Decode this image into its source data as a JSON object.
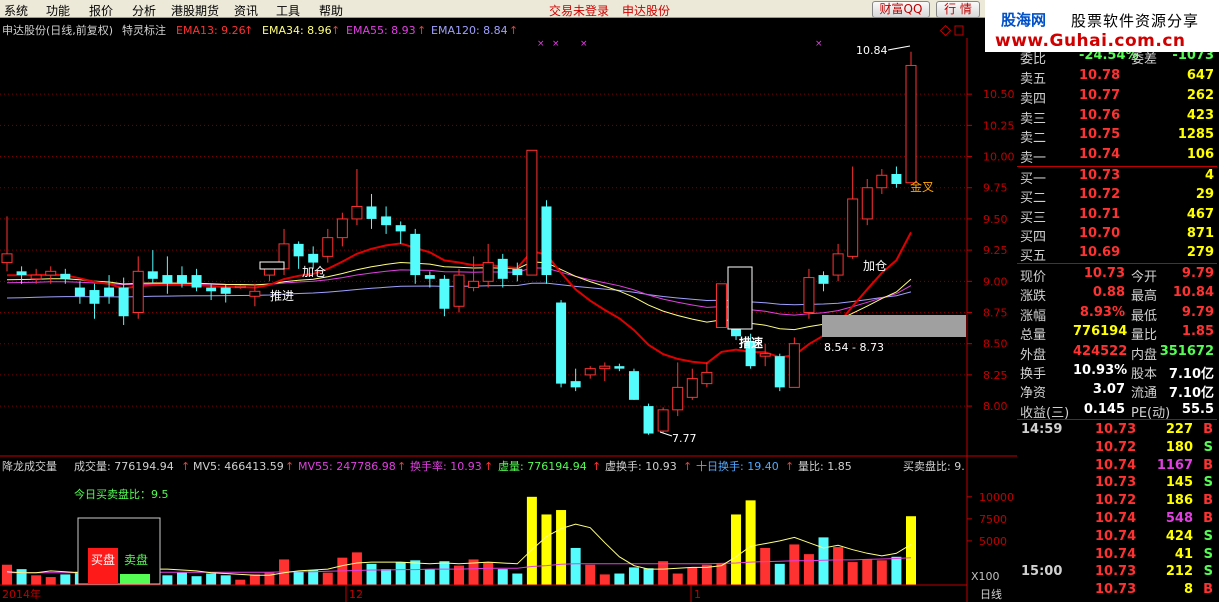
{
  "menu": {
    "items": [
      "系统",
      "功能",
      "报价",
      "分析",
      "港股期货",
      "资讯",
      "工具",
      "帮助"
    ],
    "notice_login": "交易未登录",
    "notice_stock": "申达股份",
    "btn_wealth": "财富QQ",
    "btn_quote": "行 情"
  },
  "logo": {
    "name": "股海网",
    "slogan": "股票软件资源分享",
    "url": "www.Guhai.com.cn"
  },
  "chart_header": {
    "stock": "申达股份(日线,前复权)",
    "indicator": "特灵标注",
    "ema13": "EMA13: 9.26",
    "ema34": "EMA34: 8.96",
    "ema55": "EMA55: 8.93",
    "ema120": "EMA120: 8.84"
  },
  "colors": {
    "up": "#ff3232",
    "down": "#54fcfc",
    "ema13": "#e00000",
    "ema34": "#ffff7f",
    "ema55": "#e040e0",
    "ema120": "#a0a0ff",
    "grid": "#7a0000",
    "axis": "#c00000"
  },
  "annotations": {
    "tuijin": "推进",
    "jiacang1": "加仓",
    "jiacang2": "加仓",
    "cuosu": "措速",
    "jincha": "金叉",
    "high_label": "10.84",
    "low_label": "7.77",
    "range_label": "8.54 - 8.73"
  },
  "price_axis": [
    "10.50",
    "10.25",
    "10.00",
    "9.75",
    "9.50",
    "9.25",
    "9.00",
    "8.75",
    "8.50",
    "8.25",
    "8.00"
  ],
  "vol_axis": [
    "10000",
    "7500",
    "5000"
  ],
  "vol_header": {
    "title": "降龙成交量",
    "vol": "成交量: 776194.94",
    "mv5": "MV5: 466413.59",
    "mv55": "MV55: 247786.98",
    "turnover": "换手率: 10.93",
    "vvol": "虚量: 776194.94",
    "vturn": "虚换手: 10.93",
    "ten_turn": "十日换手: 19.40",
    "ratio": "量比: 1.85",
    "bs_ratio": "买卖盘比: 9."
  },
  "today_ratio": "今日买卖盘比：9.5",
  "buy_label": "买盘",
  "sell_label": "卖盘",
  "x_labels": [
    "2014年",
    "12",
    "1"
  ],
  "x100": "X100",
  "period": "日线",
  "chart_data": {
    "type": "candlestick",
    "ylim": [
      7.6,
      10.95
    ],
    "candles": [
      {
        "o": 9.15,
        "c": 9.22,
        "h": 9.52,
        "l": 9.08
      },
      {
        "o": 9.08,
        "c": 9.05,
        "h": 9.12,
        "l": 8.98
      },
      {
        "o": 9.02,
        "c": 9.05,
        "h": 9.1,
        "l": 8.98
      },
      {
        "o": 9.05,
        "c": 9.08,
        "h": 9.12,
        "l": 8.98
      },
      {
        "o": 9.06,
        "c": 9.02,
        "h": 9.1,
        "l": 8.98
      },
      {
        "o": 8.95,
        "c": 8.88,
        "h": 9.0,
        "l": 8.82
      },
      {
        "o": 8.93,
        "c": 8.82,
        "h": 8.98,
        "l": 8.7
      },
      {
        "o": 8.95,
        "c": 8.88,
        "h": 9.05,
        "l": 8.82
      },
      {
        "o": 8.95,
        "c": 8.72,
        "h": 9.03,
        "l": 8.65
      },
      {
        "o": 8.75,
        "c": 9.08,
        "h": 9.2,
        "l": 8.7
      },
      {
        "o": 9.08,
        "c": 9.02,
        "h": 9.25,
        "l": 8.98
      },
      {
        "o": 9.05,
        "c": 8.98,
        "h": 9.2,
        "l": 8.9
      },
      {
        "o": 9.05,
        "c": 8.98,
        "h": 9.12,
        "l": 8.95
      },
      {
        "o": 9.05,
        "c": 8.95,
        "h": 9.1,
        "l": 8.92
      },
      {
        "o": 8.95,
        "c": 8.92,
        "h": 8.98,
        "l": 8.85
      },
      {
        "o": 8.95,
        "c": 8.9,
        "h": 8.97,
        "l": 8.83
      },
      {
        "o": 8.95,
        "c": 8.96,
        "h": 8.97,
        "l": 8.94
      },
      {
        "o": 8.88,
        "c": 8.92,
        "h": 8.98,
        "l": 8.8
      },
      {
        "o": 9.05,
        "c": 9.1,
        "h": 9.12,
        "l": 9.0
      },
      {
        "o": 9.1,
        "c": 9.3,
        "h": 9.42,
        "l": 9.05
      },
      {
        "o": 9.3,
        "c": 9.2,
        "h": 9.32,
        "l": 9.1
      },
      {
        "o": 9.22,
        "c": 9.15,
        "h": 9.28,
        "l": 9.1
      },
      {
        "o": 9.2,
        "c": 9.35,
        "h": 9.42,
        "l": 9.15
      },
      {
        "o": 9.35,
        "c": 9.5,
        "h": 9.55,
        "l": 9.28
      },
      {
        "o": 9.5,
        "c": 9.6,
        "h": 9.9,
        "l": 9.45
      },
      {
        "o": 9.6,
        "c": 9.5,
        "h": 9.7,
        "l": 9.42
      },
      {
        "o": 9.52,
        "c": 9.45,
        "h": 9.6,
        "l": 9.38
      },
      {
        "o": 9.45,
        "c": 9.4,
        "h": 9.48,
        "l": 9.3
      },
      {
        "o": 9.38,
        "c": 9.05,
        "h": 9.42,
        "l": 8.98
      },
      {
        "o": 9.05,
        "c": 9.02,
        "h": 9.08,
        "l": 8.95
      },
      {
        "o": 9.02,
        "c": 8.78,
        "h": 9.05,
        "l": 8.72
      },
      {
        "o": 8.8,
        "c": 9.05,
        "h": 9.1,
        "l": 8.75
      },
      {
        "o": 8.95,
        "c": 9.0,
        "h": 9.2,
        "l": 8.92
      },
      {
        "o": 9.0,
        "c": 9.15,
        "h": 9.3,
        "l": 8.95
      },
      {
        "o": 9.18,
        "c": 9.02,
        "h": 9.22,
        "l": 8.95
      },
      {
        "o": 9.1,
        "c": 9.05,
        "h": 9.15,
        "l": 9.0
      },
      {
        "o": 9.05,
        "c": 10.05,
        "h": 10.05,
        "l": 9.05
      },
      {
        "o": 9.6,
        "c": 9.05,
        "h": 9.65,
        "l": 8.98
      },
      {
        "o": 8.83,
        "c": 8.18,
        "h": 8.85,
        "l": 8.15
      },
      {
        "o": 8.2,
        "c": 8.15,
        "h": 8.3,
        "l": 8.12
      },
      {
        "o": 8.25,
        "c": 8.3,
        "h": 8.32,
        "l": 8.22
      },
      {
        "o": 8.3,
        "c": 8.32,
        "h": 8.35,
        "l": 8.2
      },
      {
        "o": 8.32,
        "c": 8.3,
        "h": 8.34,
        "l": 8.28
      },
      {
        "o": 8.28,
        "c": 8.05,
        "h": 8.3,
        "l": 8.05
      },
      {
        "o": 8.0,
        "c": 7.78,
        "h": 8.02,
        "l": 7.77
      },
      {
        "o": 7.8,
        "c": 7.97,
        "h": 7.99,
        "l": 7.78
      },
      {
        "o": 7.97,
        "c": 8.15,
        "h": 8.35,
        "l": 7.92
      },
      {
        "o": 8.07,
        "c": 8.22,
        "h": 8.3,
        "l": 8.05
      },
      {
        "o": 8.18,
        "c": 8.27,
        "h": 8.35,
        "l": 8.15
      },
      {
        "o": 8.63,
        "c": 8.98,
        "h": 8.98,
        "l": 8.63
      },
      {
        "o": 8.79,
        "c": 8.56,
        "h": 8.82,
        "l": 8.53
      },
      {
        "o": 8.52,
        "c": 8.32,
        "h": 8.58,
        "l": 8.3
      },
      {
        "o": 8.4,
        "c": 8.42,
        "h": 8.5,
        "l": 8.32
      },
      {
        "o": 8.4,
        "c": 8.15,
        "h": 8.42,
        "l": 8.12
      },
      {
        "o": 8.15,
        "c": 8.5,
        "h": 8.55,
        "l": 8.15
      },
      {
        "o": 8.75,
        "c": 9.03,
        "h": 9.1,
        "l": 8.7
      },
      {
        "o": 9.05,
        "c": 8.98,
        "h": 9.08,
        "l": 8.92
      },
      {
        "o": 9.05,
        "c": 9.22,
        "h": 9.3,
        "l": 9.0
      },
      {
        "o": 9.2,
        "c": 9.66,
        "h": 9.92,
        "l": 9.18
      },
      {
        "o": 9.5,
        "c": 9.75,
        "h": 9.82,
        "l": 9.45
      },
      {
        "o": 9.75,
        "c": 9.85,
        "h": 9.9,
        "l": 9.7
      },
      {
        "o": 9.86,
        "c": 9.78,
        "h": 9.92,
        "l": 9.75
      },
      {
        "o": 9.79,
        "c": 10.73,
        "h": 10.84,
        "l": 9.79
      }
    ],
    "volume_scale_max": 11000,
    "volumes": [
      2300,
      1800,
      1100,
      900,
      1200,
      1500,
      1800,
      1100,
      1400,
      2900,
      1700,
      1100,
      1400,
      1000,
      1300,
      1100,
      600,
      1200,
      1400,
      2900,
      1500,
      1700,
      1400,
      3100,
      3700,
      2400,
      1800,
      2600,
      2800,
      1800,
      2700,
      2200,
      2900,
      2600,
      1800,
      1300,
      10000,
      8000,
      8500,
      4200,
      2300,
      1200,
      1300,
      2000,
      1900,
      2700,
      1300,
      2000,
      2300,
      2400,
      8000,
      9600,
      4200,
      2400,
      4600,
      3500,
      5400,
      4300,
      2600,
      2900,
      2800,
      3200,
      7800
    ],
    "mv5": [
      1500,
      1400,
      1400,
      1600,
      1500,
      1400,
      1400,
      1400,
      1600,
      1800,
      1800,
      1800,
      1700,
      1600,
      1400,
      1300,
      1200,
      1100,
      1100,
      1400,
      1600,
      1700,
      1800,
      2200,
      2500,
      2600,
      2600,
      2600,
      2500,
      2400,
      2500,
      2400,
      2500,
      2600,
      2500,
      2400,
      4000,
      5500,
      6400,
      6900,
      6500,
      4800,
      3200,
      2200,
      1800,
      1800,
      1900,
      2000,
      2000,
      2200,
      3200,
      4400,
      4700,
      5000,
      5400,
      4800,
      4200,
      4500,
      4000,
      3600,
      3300,
      3600,
      4600
    ],
    "mv55": [
      1400,
      1400,
      1400,
      1400,
      1400,
      1400,
      1400,
      1400,
      1400,
      1450,
      1450,
      1450,
      1450,
      1450,
      1450,
      1450,
      1450,
      1450,
      1450,
      1500,
      1500,
      1500,
      1550,
      1600,
      1650,
      1700,
      1700,
      1750,
      1750,
      1800,
      1800,
      1800,
      1850,
      1900,
      1900,
      1900,
      2100,
      2200,
      2350,
      2400,
      2400,
      2400,
      2400,
      2400,
      2400,
      2400,
      2400,
      2400,
      2400,
      2450,
      2500,
      2600,
      2650,
      2700,
      2750,
      2750,
      2800,
      2850,
      2850,
      2900,
      2950,
      3000,
      3100
    ]
  },
  "quote": {
    "weibi_label": "委比",
    "weibi": "-24.54%",
    "weicha_label": "委差",
    "weicha": "-1073",
    "asks": [
      {
        "label": "卖五",
        "price": "10.78",
        "vol": "647"
      },
      {
        "label": "卖四",
        "price": "10.77",
        "vol": "262"
      },
      {
        "label": "卖三",
        "price": "10.76",
        "vol": "423"
      },
      {
        "label": "卖二",
        "price": "10.75",
        "vol": "1285"
      },
      {
        "label": "卖一",
        "price": "10.74",
        "vol": "106"
      }
    ],
    "bids": [
      {
        "label": "买一",
        "price": "10.73",
        "vol": "4"
      },
      {
        "label": "买二",
        "price": "10.72",
        "vol": "29"
      },
      {
        "label": "买三",
        "price": "10.71",
        "vol": "467"
      },
      {
        "label": "买四",
        "price": "10.70",
        "vol": "871"
      },
      {
        "label": "买五",
        "price": "10.69",
        "vol": "279"
      }
    ],
    "stats": [
      {
        "l1": "现价",
        "v1": "10.73",
        "c1": "#ff3232",
        "l2": "今开",
        "v2": "9.79",
        "c2": "#ff3232"
      },
      {
        "l1": "涨跌",
        "v1": "0.88",
        "c1": "#ff3232",
        "l2": "最高",
        "v2": "10.84",
        "c2": "#ff3232"
      },
      {
        "l1": "涨幅",
        "v1": "8.93%",
        "c1": "#ff3232",
        "l2": "最低",
        "v2": "9.79",
        "c2": "#ff3232"
      },
      {
        "l1": "总量",
        "v1": "776194",
        "c1": "#ffff00",
        "l2": "量比",
        "v2": "1.85",
        "c2": "#ff3232"
      },
      {
        "l1": "外盘",
        "v1": "424522",
        "c1": "#ff3232",
        "l2": "内盘",
        "v2": "351672",
        "c2": "#54fc54"
      },
      {
        "l1": "换手",
        "v1": "10.93%",
        "c1": "#ffffff",
        "l2": "股本",
        "v2": "7.10亿",
        "c2": "#ffffff"
      },
      {
        "l1": "净资",
        "v1": "3.07",
        "c1": "#ffffff",
        "l2": "流通",
        "v2": "7.10亿",
        "c2": "#ffffff"
      },
      {
        "l1": "收益(三)",
        "v1": "0.145",
        "c1": "#ffffff",
        "l2": "PE(动)",
        "v2": "55.5",
        "c2": "#ffffff"
      }
    ],
    "ticks": [
      {
        "time": "14:59",
        "price": "10.73",
        "vol": "227",
        "vc": "#ffff00",
        "bs": "B",
        "bc": "#ff3232"
      },
      {
        "time": "",
        "price": "10.72",
        "vol": "180",
        "vc": "#ffff00",
        "bs": "S",
        "bc": "#54fc54"
      },
      {
        "time": "",
        "price": "10.74",
        "vol": "1167",
        "vc": "#e040e0",
        "bs": "B",
        "bc": "#ff3232"
      },
      {
        "time": "",
        "price": "10.73",
        "vol": "145",
        "vc": "#ffff00",
        "bs": "S",
        "bc": "#54fc54"
      },
      {
        "time": "",
        "price": "10.72",
        "vol": "186",
        "vc": "#ffff00",
        "bs": "B",
        "bc": "#ff3232"
      },
      {
        "time": "",
        "price": "10.74",
        "vol": "548",
        "vc": "#e040e0",
        "bs": "B",
        "bc": "#ff3232"
      },
      {
        "time": "",
        "price": "10.74",
        "vol": "424",
        "vc": "#ffff00",
        "bs": "S",
        "bc": "#54fc54"
      },
      {
        "time": "",
        "price": "10.74",
        "vol": "41",
        "vc": "#ffff00",
        "bs": "S",
        "bc": "#54fc54"
      },
      {
        "time": "15:00",
        "price": "10.73",
        "vol": "212",
        "vc": "#ffff00",
        "bs": "S",
        "bc": "#54fc54"
      },
      {
        "time": "",
        "price": "10.73",
        "vol": "8",
        "vc": "#ffff00",
        "bs": "B",
        "bc": "#ff3232"
      }
    ]
  }
}
